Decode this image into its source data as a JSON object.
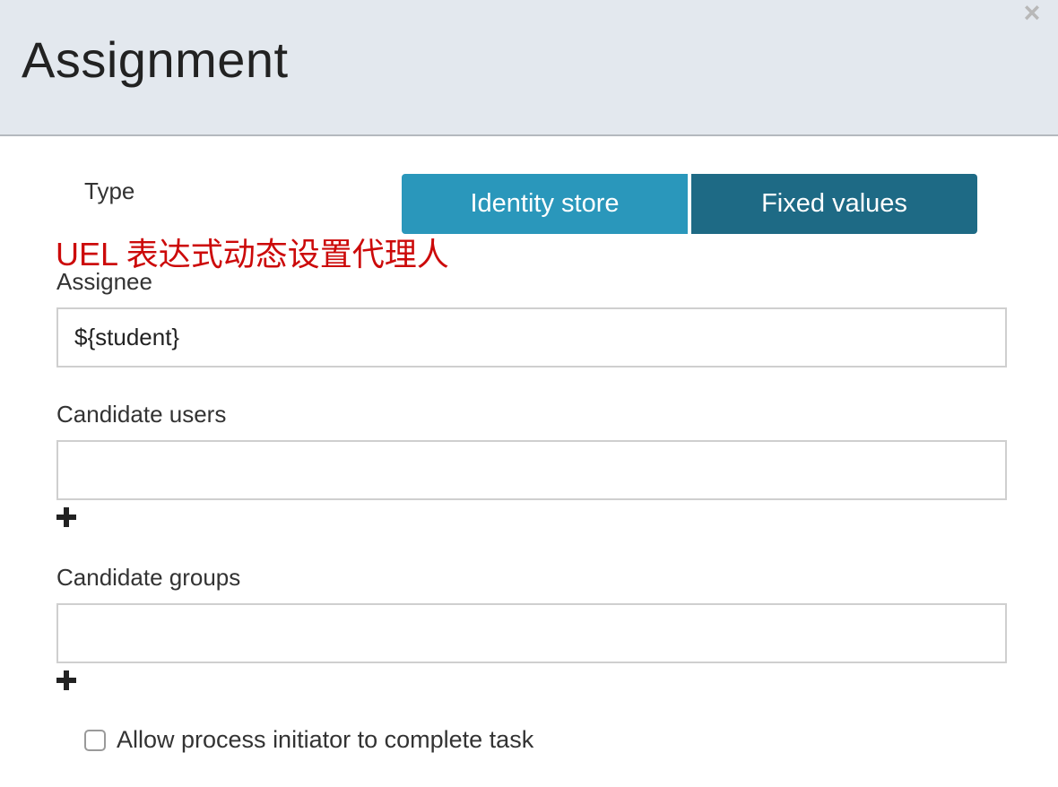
{
  "dialog": {
    "title": "Assignment",
    "close_glyph": "×"
  },
  "type_section": {
    "label": "Type",
    "options": [
      {
        "label": "Identity store",
        "active": false
      },
      {
        "label": "Fixed values",
        "active": true
      }
    ]
  },
  "annotation": "UEL 表达式动态设置代理人",
  "fields": {
    "assignee": {
      "label": "Assignee",
      "value": "${student}",
      "placeholder": ""
    },
    "candidate_users": {
      "label": "Candidate users",
      "value": "",
      "placeholder": ""
    },
    "candidate_groups": {
      "label": "Candidate groups",
      "value": "",
      "placeholder": ""
    }
  },
  "allow_initiator": {
    "label": "Allow process initiator to complete task",
    "checked": false
  },
  "colors": {
    "header_bg": "#e3e8ee",
    "toggle_inactive": "#2a97bb",
    "toggle_active": "#1e6a85",
    "annotation": "#cc0a0a"
  },
  "icons": {
    "close": "close-icon",
    "add_candidate_user": "plus-icon",
    "add_candidate_group": "plus-icon"
  }
}
